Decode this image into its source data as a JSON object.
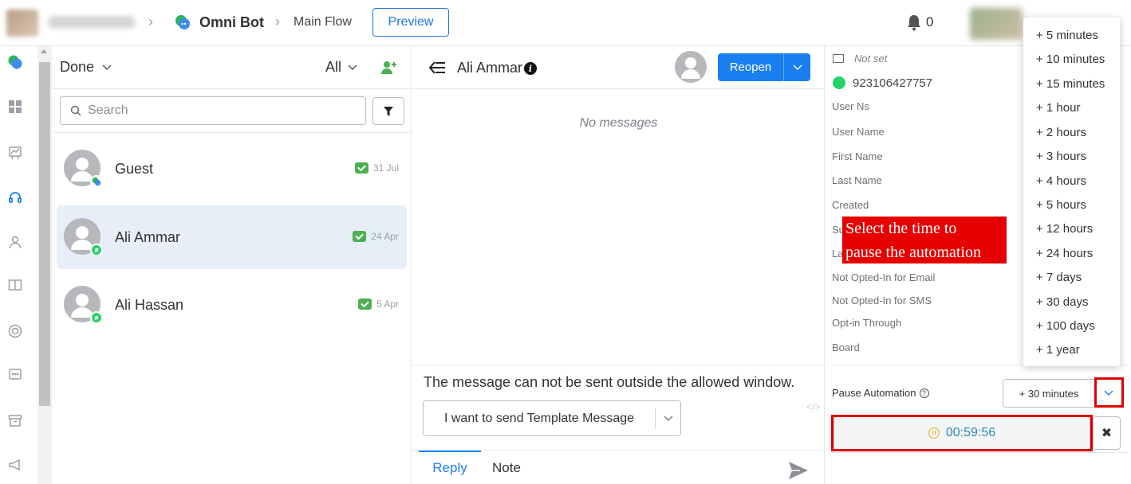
{
  "header": {
    "bot_name": "Omni Bot",
    "flow_name": "Main Flow",
    "preview_label": "Preview",
    "notification_count": "0"
  },
  "list": {
    "status_filter": "Done",
    "channel_filter": "All",
    "search_placeholder": "Search",
    "conversations": [
      {
        "name": "Guest",
        "date": "31 Jul",
        "channel": "omni-bot"
      },
      {
        "name": "Ali Ammar",
        "date": "24 Apr",
        "channel": "whatsapp",
        "active": true
      },
      {
        "name": "Ali Hassan",
        "date": "5 Apr",
        "channel": "whatsapp"
      }
    ]
  },
  "chat": {
    "contact_name": "Ali Ammar",
    "reopen_label": "Reopen",
    "empty_text": "No messages",
    "window_warning": "The message can not be sent outside the allowed window.",
    "template_select": "I want to send Template Message",
    "tab_reply": "Reply",
    "tab_note": "Note"
  },
  "details": {
    "email": "Not set",
    "phone": "923106427757",
    "fields": [
      "User Ns",
      "User Name",
      "First Name",
      "Last Name",
      "Created",
      "Su",
      "La",
      "Not Opted-In for Email",
      "Not Opted-In for SMS",
      "Opt-in Through",
      "Board"
    ],
    "pause_label": "Pause Automation",
    "pause_value": "+ 30 minutes",
    "timer": "00:59:56"
  },
  "pause_menu": {
    "options": [
      "+ 5 minutes",
      "+ 10 minutes",
      "+ 15 minutes",
      "+ 1 hour",
      "+ 2 hours",
      "+ 3 hours",
      "+ 4 hours",
      "+ 5 hours",
      "+ 12 hours",
      "+ 24 hours",
      "+ 7 days",
      "+ 30 days",
      "+ 100 days",
      "+ 1 year"
    ]
  },
  "annotation": {
    "callout_line1": "Select the time to",
    "callout_line2": "pause the automation"
  },
  "colors": {
    "primary": "#1a7ff0",
    "whatsapp": "#25d366",
    "annotation": "#e00000",
    "active_row": "#e7eef8"
  }
}
